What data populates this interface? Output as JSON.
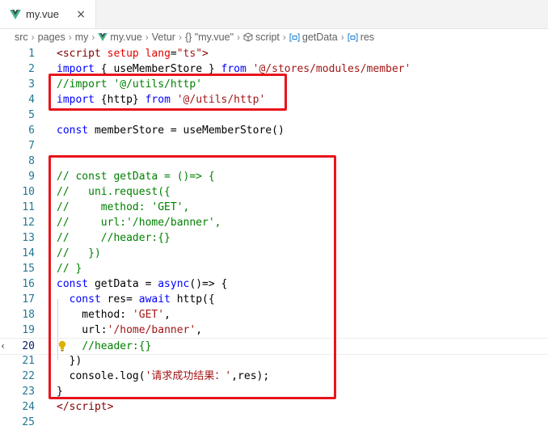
{
  "tab": {
    "filename": "my.vue",
    "close_glyph": "×",
    "icon": "vue-icon"
  },
  "breadcrumb": [
    "src",
    "pages",
    "my",
    "my.vue",
    "Vetur",
    "{} \"my.vue\"",
    "script",
    "getData",
    "res"
  ],
  "breadcrumb_sep": "›",
  "colors": {
    "keyword": "#0000ff",
    "string": "#a31515",
    "comment": "#008000",
    "text": "#000000",
    "tag": "#800000",
    "attr": "#e50000",
    "highlight_box": "#e8151b"
  },
  "code_lines": [
    {
      "n": "1",
      "tokens": [
        [
          "<",
          "d"
        ],
        [
          "script",
          "tag"
        ],
        [
          " ",
          "t"
        ],
        [
          "setup",
          "attr"
        ],
        [
          " ",
          "t"
        ],
        [
          "lang",
          "attr"
        ],
        [
          "=",
          "t"
        ],
        [
          "\"ts\"",
          "str"
        ],
        [
          ">",
          "d"
        ]
      ]
    },
    {
      "n": "2",
      "tokens": [
        [
          "import",
          "kw"
        ],
        [
          " { useMemberStore } ",
          "t"
        ],
        [
          "from",
          "kw"
        ],
        [
          " ",
          "t"
        ],
        [
          "'@/stores/modules/member'",
          "str"
        ]
      ]
    },
    {
      "n": "3",
      "tokens": [
        [
          "//import '@/utils/http'",
          "cm"
        ]
      ]
    },
    {
      "n": "4",
      "tokens": [
        [
          "import",
          "kw"
        ],
        [
          " {http} ",
          "t"
        ],
        [
          "from",
          "kw"
        ],
        [
          " ",
          "t"
        ],
        [
          "'@/utils/http'",
          "str"
        ]
      ]
    },
    {
      "n": "5",
      "tokens": []
    },
    {
      "n": "6",
      "tokens": [
        [
          "const",
          "kw"
        ],
        [
          " memberStore = useMemberStore()",
          "t"
        ]
      ]
    },
    {
      "n": "7",
      "tokens": []
    },
    {
      "n": "8",
      "tokens": []
    },
    {
      "n": "9",
      "tokens": [
        [
          "// const getData = ()=> {",
          "cm"
        ]
      ]
    },
    {
      "n": "10",
      "tokens": [
        [
          "//   uni.request({",
          "cm"
        ]
      ]
    },
    {
      "n": "11",
      "tokens": [
        [
          "//     method: 'GET',",
          "cm"
        ]
      ]
    },
    {
      "n": "12",
      "tokens": [
        [
          "//     url:'/home/banner',",
          "cm"
        ]
      ]
    },
    {
      "n": "13",
      "tokens": [
        [
          "//     //header:{}",
          "cm"
        ]
      ]
    },
    {
      "n": "14",
      "tokens": [
        [
          "//   })",
          "cm"
        ]
      ]
    },
    {
      "n": "15",
      "tokens": [
        [
          "// }",
          "cm"
        ]
      ]
    },
    {
      "n": "16",
      "tokens": [
        [
          "const",
          "kw"
        ],
        [
          " getData = ",
          "t"
        ],
        [
          "async",
          "kw"
        ],
        [
          "()=> {",
          "t"
        ]
      ]
    },
    {
      "n": "17",
      "tokens": [
        [
          "  ",
          "t"
        ],
        [
          "const",
          "kw"
        ],
        [
          " res= ",
          "t"
        ],
        [
          "await",
          "kw"
        ],
        [
          " http({",
          "t"
        ]
      ]
    },
    {
      "n": "18",
      "tokens": [
        [
          "    method: ",
          "t"
        ],
        [
          "'GET'",
          "str"
        ],
        [
          ",",
          "t"
        ]
      ]
    },
    {
      "n": "19",
      "tokens": [
        [
          "    url:",
          "t"
        ],
        [
          "'/home/banner'",
          "str"
        ],
        [
          ",",
          "t"
        ]
      ]
    },
    {
      "n": "20",
      "tokens": [
        [
          "    ",
          "t"
        ],
        [
          "//header:{}",
          "cm"
        ]
      ]
    },
    {
      "n": "21",
      "tokens": [
        [
          "  })",
          "t"
        ]
      ]
    },
    {
      "n": "22",
      "tokens": [
        [
          "  console.log(",
          "t"
        ],
        [
          "'请求成功结果：'",
          "str"
        ],
        [
          ",res);",
          "t"
        ]
      ]
    },
    {
      "n": "23",
      "tokens": [
        [
          "}",
          "t"
        ]
      ]
    },
    {
      "n": "24",
      "tokens": [
        [
          "<",
          "d"
        ],
        [
          "/script",
          "tag"
        ],
        [
          ">",
          "d"
        ]
      ]
    },
    {
      "n": "25",
      "tokens": []
    }
  ],
  "active_line": "20",
  "lightbulb_line": "20",
  "left_edge_char": "‹"
}
